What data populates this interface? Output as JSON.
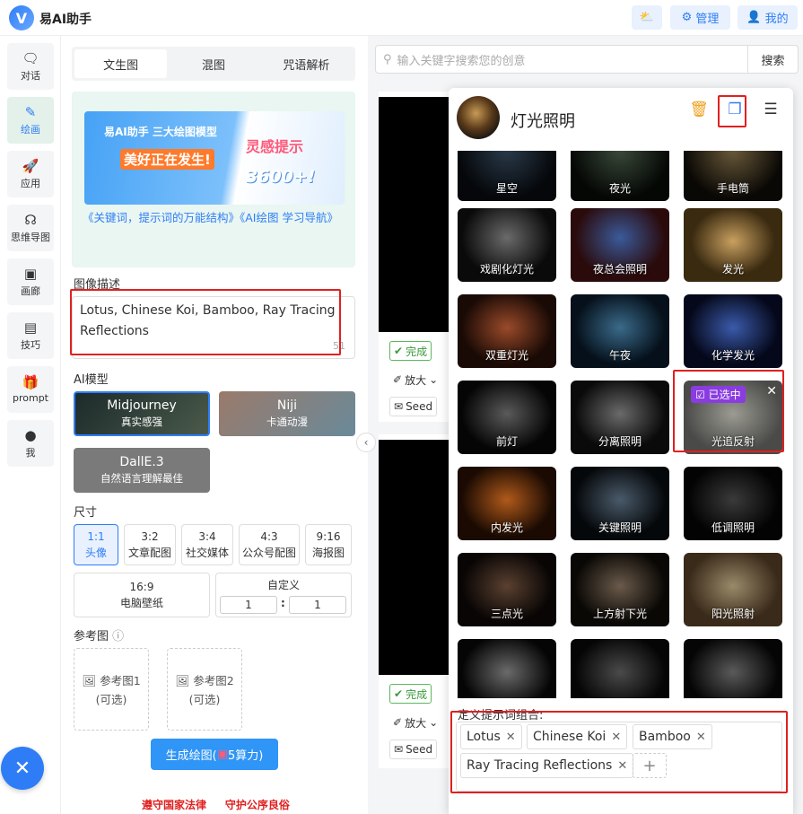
{
  "app": {
    "logo_letter": "V",
    "title": "易AI助手"
  },
  "topbar": {
    "manage_label": "管理",
    "me_label": "我的"
  },
  "nav": [
    {
      "label": "对话",
      "icon": "chat-icon"
    },
    {
      "label": "绘画",
      "icon": "paint-icon"
    },
    {
      "label": "应用",
      "icon": "rocket-icon"
    },
    {
      "label": "思维导图",
      "icon": "mindmap-icon"
    },
    {
      "label": "画廊",
      "icon": "gallery-icon"
    },
    {
      "label": "技巧",
      "icon": "book-icon"
    },
    {
      "label": "prompt",
      "icon": "gift-icon"
    },
    {
      "label": "我",
      "icon": "user-icon"
    }
  ],
  "tabs": [
    "文生图",
    "混图",
    "咒语解析"
  ],
  "banner": {
    "line1": "易AI助手 三大绘图模型",
    "line2": "美好正在发生!",
    "line3": "灵感提示",
    "line4": "3600+!",
    "link": "《关键词，提示词的万能结构》《AI绘图 学习导航》"
  },
  "description": {
    "label": "图像描述",
    "value": "Lotus, Chinese Koi, Bamboo, Ray Tracing Reflections",
    "count": "51"
  },
  "models": {
    "label": "AI模型",
    "items": [
      {
        "name": "Midjourney",
        "sub": "真实感强"
      },
      {
        "name": "Niji",
        "sub": "卡通动漫"
      },
      {
        "name": "DallE.3",
        "sub": "自然语言理解最佳"
      }
    ]
  },
  "sizes": {
    "label": "尺寸",
    "items": [
      {
        "ratio": "1:1",
        "use": "头像"
      },
      {
        "ratio": "3:2",
        "use": "文章配图"
      },
      {
        "ratio": "3:4",
        "use": "社交媒体"
      },
      {
        "ratio": "4:3",
        "use": "公众号配图"
      },
      {
        "ratio": "9:16",
        "use": "海报图"
      },
      {
        "ratio": "16:9",
        "use": "电脑壁纸"
      }
    ],
    "custom_label": "自定义",
    "custom_w": "1",
    "custom_h": "1",
    "separator": ":"
  },
  "reference": {
    "label": "参考图",
    "info": "ⓘ",
    "img1": "参考图1",
    "img2": "参考图2",
    "optional": "(可选)"
  },
  "generate": {
    "label": "生成绘图(",
    "cost": "5算力)"
  },
  "footer": {
    "text1": "遵守国家法律",
    "text2": "守护公序良俗"
  },
  "search": {
    "placeholder": "输入关键字搜索您的创意",
    "button": "搜索"
  },
  "cards": {
    "done": "完成",
    "zoom": "放大",
    "seed": "Seed"
  },
  "overlay": {
    "title": "灯光照明",
    "thumbs": [
      "星空",
      "夜光",
      "手电筒",
      "戏剧化灯光",
      "夜总会照明",
      "发光",
      "双重灯光",
      "午夜",
      "化学发光",
      "前灯",
      "分离照明",
      "光追反射",
      "内发光",
      "关键照明",
      "低调照明",
      "三点光",
      "上方射下光",
      "阳光照射",
      "",
      "",
      ""
    ],
    "selected_badge": "已选中",
    "combo_title": "定义提示词组合:",
    "chips": [
      "Lotus",
      "Chinese Koi",
      "Bamboo",
      "Ray Tracing Reflections"
    ],
    "chip_close": "✕",
    "add": "+"
  },
  "colors": {
    "accent": "#2f7df6",
    "highlight": "#e02020",
    "selected": "#8a3ce0"
  }
}
